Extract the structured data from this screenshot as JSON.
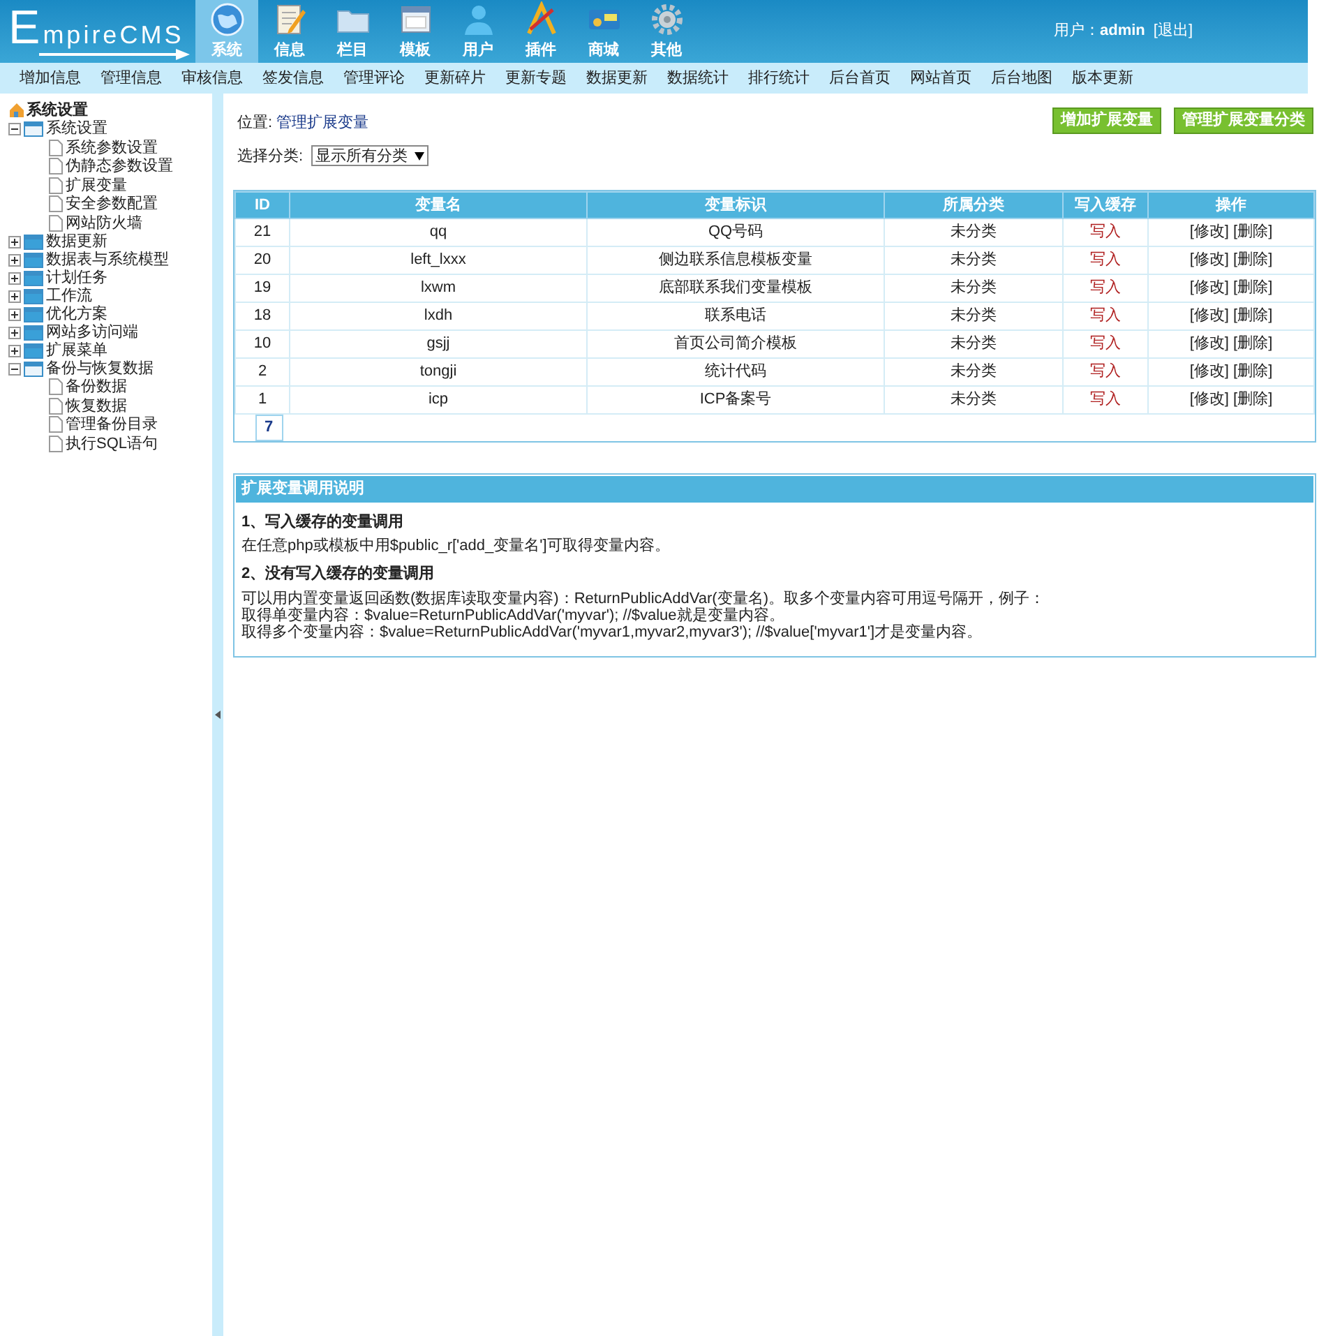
{
  "logo": {
    "text": "mpireCMS",
    "initial": "E"
  },
  "main_tabs": [
    {
      "label": "系统",
      "selected": true
    },
    {
      "label": "信息",
      "selected": false
    },
    {
      "label": "栏目",
      "selected": false
    },
    {
      "label": "模板",
      "selected": false
    },
    {
      "label": "用户",
      "selected": false
    },
    {
      "label": "插件",
      "selected": false
    },
    {
      "label": "商城",
      "selected": false
    },
    {
      "label": "其他",
      "selected": false
    }
  ],
  "user": {
    "label": "用户：",
    "name": "admin",
    "logout": "[退出]"
  },
  "quick_links": [
    "增加信息",
    "管理信息",
    "审核信息",
    "签发信息",
    "管理评论",
    "更新碎片",
    "更新专题",
    "数据更新",
    "数据统计",
    "排行统计",
    "后台首页",
    "网站首页",
    "后台地图",
    "版本更新"
  ],
  "sidebar": {
    "title": "系统设置",
    "items": [
      {
        "label": "系统设置",
        "expanded": true,
        "children": [
          {
            "label": "系统参数设置"
          },
          {
            "label": "伪静态参数设置"
          },
          {
            "label": "扩展变量"
          },
          {
            "label": "安全参数配置"
          },
          {
            "label": "网站防火墙"
          }
        ]
      },
      {
        "label": "数据更新",
        "expanded": false
      },
      {
        "label": "数据表与系统模型",
        "expanded": false
      },
      {
        "label": "计划任务",
        "expanded": false
      },
      {
        "label": "工作流",
        "expanded": false
      },
      {
        "label": "优化方案",
        "expanded": false
      },
      {
        "label": "网站多访问端",
        "expanded": false
      },
      {
        "label": "扩展菜单",
        "expanded": false
      },
      {
        "label": "备份与恢复数据",
        "expanded": true,
        "children": [
          {
            "label": "备份数据"
          },
          {
            "label": "恢复数据"
          },
          {
            "label": "管理备份目录"
          },
          {
            "label": "执行SQL语句"
          }
        ]
      }
    ]
  },
  "breadcrumb": {
    "label": "位置:",
    "link": "管理扩展变量"
  },
  "actions": [
    "增加扩展变量",
    "管理扩展变量分类"
  ],
  "filter": {
    "label": "选择分类:",
    "value": "显示所有分类"
  },
  "table": {
    "columns": [
      "ID",
      "变量名",
      "变量标识",
      "所属分类",
      "写入缓存",
      "操作"
    ],
    "rows": [
      {
        "id": "21",
        "name": "qq",
        "label": "QQ号码",
        "category": "未分类",
        "cache": "写入",
        "edit": "[修改]",
        "delete": "[删除]"
      },
      {
        "id": "20",
        "name": "left_lxxx",
        "label": "侧边联系信息模板变量",
        "category": "未分类",
        "cache": "写入",
        "edit": "[修改]",
        "delete": "[删除]"
      },
      {
        "id": "19",
        "name": "lxwm",
        "label": "底部联系我们变量模板",
        "category": "未分类",
        "cache": "写入",
        "edit": "[修改]",
        "delete": "[删除]"
      },
      {
        "id": "18",
        "name": "lxdh",
        "label": "联系电话",
        "category": "未分类",
        "cache": "写入",
        "edit": "[修改]",
        "delete": "[删除]"
      },
      {
        "id": "10",
        "name": "gsjj",
        "label": "首页公司简介模板",
        "category": "未分类",
        "cache": "写入",
        "edit": "[修改]",
        "delete": "[删除]"
      },
      {
        "id": "2",
        "name": "tongji",
        "label": "统计代码",
        "category": "未分类",
        "cache": "写入",
        "edit": "[修改]",
        "delete": "[删除]"
      },
      {
        "id": "1",
        "name": "icp",
        "label": "ICP备案号",
        "category": "未分类",
        "cache": "写入",
        "edit": "[修改]",
        "delete": "[删除]"
      }
    ],
    "page": "7"
  },
  "help": {
    "title": "扩展变量调用说明",
    "sections": [
      {
        "heading": "1、写入缓存的变量调用",
        "lines": [
          "在任意php或模板中用$public_r['add_变量名']可取得变量内容。"
        ]
      },
      {
        "heading": "2、没有写入缓存的变量调用",
        "lines": [
          "可以用内置变量返回函数(数据库读取变量内容)：ReturnPublicAddVar(变量名)。取多个变量内容可用逗号隔开，例子：",
          "取得单变量内容：$value=ReturnPublicAddVar('myvar'); //$value就是变量内容。",
          "取得多个变量内容：$value=ReturnPublicAddVar('myvar1,myvar2,myvar3'); //$value['myvar1']才是变量内容。"
        ]
      }
    ]
  }
}
